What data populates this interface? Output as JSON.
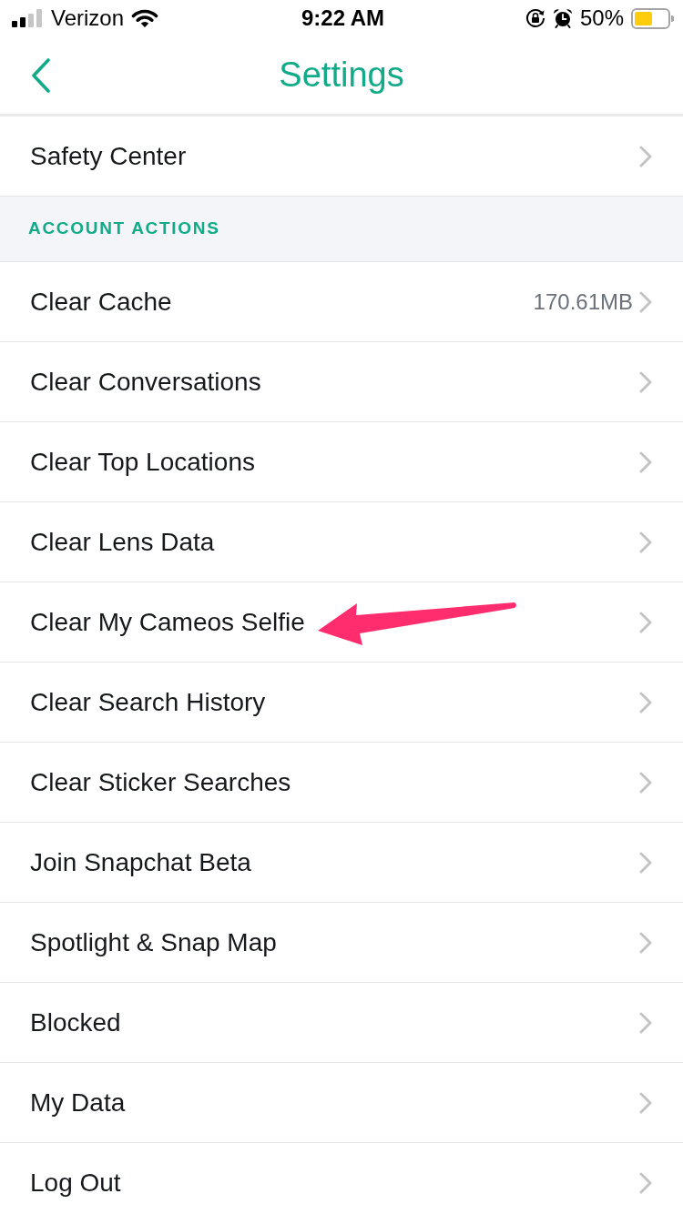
{
  "status_bar": {
    "carrier": "Verizon",
    "time": "9:22 AM",
    "battery_percent": "50%"
  },
  "header": {
    "title": "Settings"
  },
  "sections": [
    {
      "items": [
        {
          "label": "Safety Center",
          "annotated": false
        }
      ]
    },
    {
      "header": "ACCOUNT ACTIONS",
      "items": [
        {
          "label": "Clear Cache",
          "value": "170.61MB",
          "annotated": false
        },
        {
          "label": "Clear Conversations",
          "annotated": false
        },
        {
          "label": "Clear Top Locations",
          "annotated": false
        },
        {
          "label": "Clear Lens Data",
          "annotated": false
        },
        {
          "label": "Clear My Cameos Selfie",
          "annotated": true
        },
        {
          "label": "Clear Search History",
          "annotated": false
        },
        {
          "label": "Clear Sticker Searches",
          "annotated": false
        },
        {
          "label": "Join Snapchat Beta",
          "annotated": false
        },
        {
          "label": "Spotlight & Snap Map",
          "annotated": false
        },
        {
          "label": "Blocked",
          "annotated": false
        },
        {
          "label": "My Data",
          "annotated": false
        },
        {
          "label": "Log Out",
          "annotated": false
        }
      ]
    }
  ]
}
